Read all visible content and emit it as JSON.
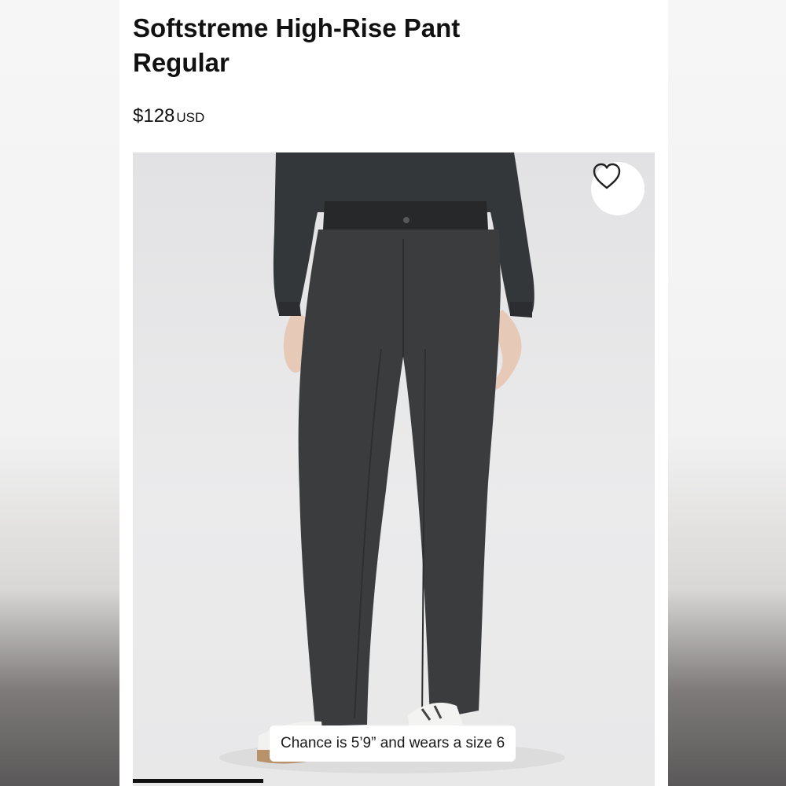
{
  "product": {
    "title_line1": "Softstreme High-Rise Pant",
    "title_line2": "Regular",
    "price": "$128",
    "currency": "USD"
  },
  "image": {
    "model_caption": "Chance is 5’9” and wears a size 6",
    "favorite_icon": "heart-outline-icon",
    "gallery_progress": 0.25
  },
  "colors": {
    "garment": "#3b3c3e",
    "background": "#e6e6e7"
  }
}
